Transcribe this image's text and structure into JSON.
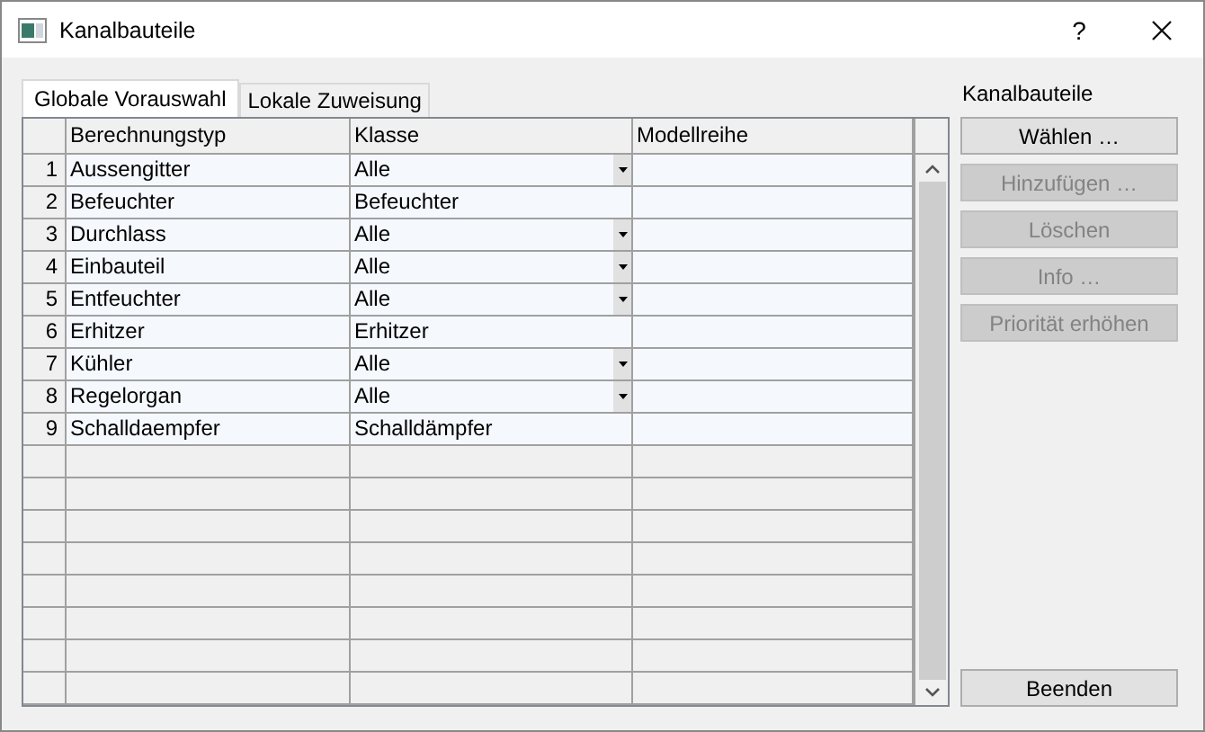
{
  "window": {
    "title": "Kanalbauteile",
    "help": "?"
  },
  "tabs": [
    {
      "label": "Globale Vorauswahl",
      "selected": true
    },
    {
      "label": "Lokale Zuweisung",
      "selected": false
    }
  ],
  "table": {
    "columns": [
      "Berechnungstyp",
      "Klasse",
      "Modellreihe"
    ],
    "rows": [
      {
        "number": "1",
        "berechnungstyp": "Aussengitter",
        "klasse": "Alle",
        "dropdown": true
      },
      {
        "number": "2",
        "berechnungstyp": "Befeuchter",
        "klasse": "Befeuchter",
        "dropdown": false
      },
      {
        "number": "3",
        "berechnungstyp": "Durchlass",
        "klasse": "Alle",
        "dropdown": true
      },
      {
        "number": "4",
        "berechnungstyp": "Einbauteil",
        "klasse": "Alle",
        "dropdown": true
      },
      {
        "number": "5",
        "berechnungstyp": "Entfeuchter",
        "klasse": "Alle",
        "dropdown": true
      },
      {
        "number": "6",
        "berechnungstyp": "Erhitzer",
        "klasse": "Erhitzer",
        "dropdown": false
      },
      {
        "number": "7",
        "berechnungstyp": "Kühler",
        "klasse": "Alle",
        "dropdown": true
      },
      {
        "number": "8",
        "berechnungstyp": "Regelorgan",
        "klasse": "Alle",
        "dropdown": true
      },
      {
        "number": "9",
        "berechnungstyp": "Schalldaempfer",
        "klasse": "Schalldämpfer",
        "dropdown": false
      }
    ]
  },
  "side_panel": {
    "label": "Kanalbauteile",
    "buttons": [
      {
        "label": "Wählen …",
        "disabled": false
      },
      {
        "label": "Hinzufügen …",
        "disabled": true
      },
      {
        "label": "Löschen",
        "disabled": true
      },
      {
        "label": "Info …",
        "disabled": true
      },
      {
        "label": "Priorität erhöhen",
        "disabled": true
      }
    ],
    "close_button": {
      "label": "Beenden",
      "disabled": false
    }
  }
}
